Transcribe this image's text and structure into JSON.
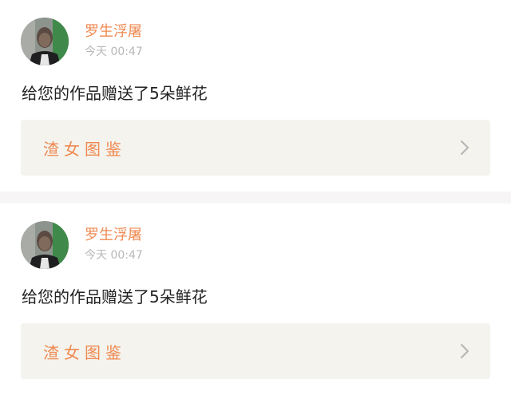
{
  "notifications": [
    {
      "username": "罗生浮屠",
      "timestamp": "今天 00:47",
      "message": "给您的作品赠送了5朵鲜花",
      "work_title": "渣女图鉴",
      "avatar_icon": "user-photo-avatar",
      "link_icon": "chevron-right-icon"
    },
    {
      "username": "罗生浮屠",
      "timestamp": "今天 00:47",
      "message": "给您的作品赠送了5朵鲜花",
      "work_title": "渣女图鉴",
      "avatar_icon": "user-photo-avatar",
      "link_icon": "chevron-right-icon"
    }
  ],
  "colors": {
    "accent": "#ef8a52",
    "timestamp": "#b8b8b8",
    "link_background": "#f4f3ed",
    "separator": "#f7f5f5"
  }
}
